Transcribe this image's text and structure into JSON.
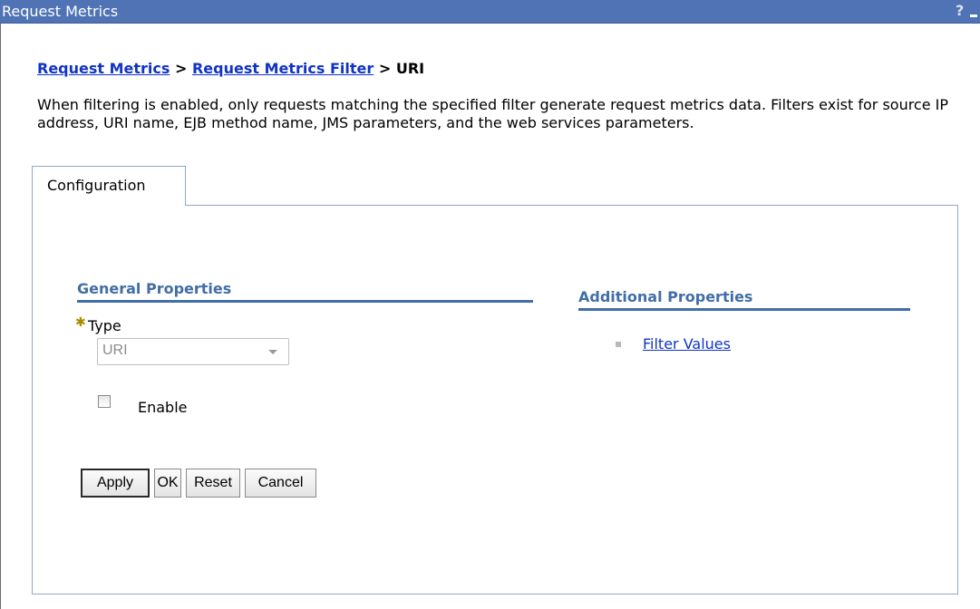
{
  "window": {
    "title": "Request Metrics",
    "help_label": "?",
    "minimize_label": "minimize"
  },
  "breadcrumb": {
    "items": [
      "Request Metrics",
      "Request Metrics Filter"
    ],
    "separator": ">",
    "current": "URI"
  },
  "description": "When filtering is enabled, only requests matching the specified filter generate request metrics data. Filters exist for source IP address, URI name, EJB method name, JMS parameters, and the web services parameters.",
  "tabs": [
    {
      "label": "Configuration",
      "selected": true
    }
  ],
  "general_properties": {
    "header": "General Properties",
    "type_field": {
      "required_marker": "✱",
      "label": "Type",
      "value": "URI",
      "disabled": true
    },
    "enable_checkbox": {
      "label": "Enable",
      "checked": false
    }
  },
  "buttons": {
    "apply": "Apply",
    "ok": "OK",
    "reset": "Reset",
    "cancel": "Cancel"
  },
  "additional_properties": {
    "header": "Additional Properties",
    "links": [
      {
        "label": "Filter Values"
      }
    ]
  },
  "colors": {
    "titlebar": "#4f73b4",
    "link": "#1034c4",
    "section_header": "#416ea6",
    "panel_border": "#8fa8c8"
  }
}
